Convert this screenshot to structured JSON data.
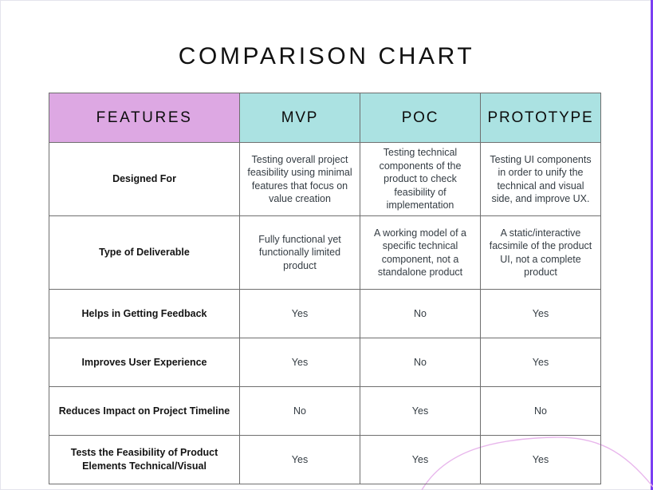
{
  "page": {
    "title": "COMPARISON CHART",
    "accent_color": "#7b3ff2",
    "deco_curve_color": "#e8b6ec",
    "border_color": "#e4e4ec",
    "background": "#ffffff"
  },
  "table": {
    "header": {
      "feature_label": "FEATURES",
      "feature_bg": "#dda8e3",
      "column_bg": "#abe2e2",
      "columns": [
        {
          "label": "MVP"
        },
        {
          "label": "POC"
        },
        {
          "label": "PROTOTYPE"
        }
      ]
    },
    "rows": [
      {
        "feature": "Designed For",
        "type": "description",
        "cells": [
          "Testing overall project feasibility using minimal features that focus on value creation",
          "Testing technical components of the product to check feasibility of implementation",
          "Testing UI components in order to unify the technical and visual side, and improve UX."
        ]
      },
      {
        "feature": "Type of Deliverable",
        "type": "description",
        "cells": [
          "Fully functional yet functionally limited product",
          "A working model of a specific technical component, not a standalone product",
          "A static/interactive facsimile of the product UI, not a complete product"
        ]
      },
      {
        "feature": "Helps in Getting Feedback",
        "type": "yesno",
        "cells": [
          "Yes",
          "No",
          "Yes"
        ]
      },
      {
        "feature": "Improves User Experience",
        "type": "yesno",
        "cells": [
          "Yes",
          "No",
          "Yes"
        ]
      },
      {
        "feature": "Reduces Impact on Project Timeline",
        "type": "yesno",
        "cells": [
          "No",
          "Yes",
          "No"
        ]
      },
      {
        "feature": "Tests the Feasibility of Product Elements Technical/Visual",
        "type": "yesno",
        "cells": [
          "Yes",
          "Yes",
          "Yes"
        ]
      }
    ]
  }
}
